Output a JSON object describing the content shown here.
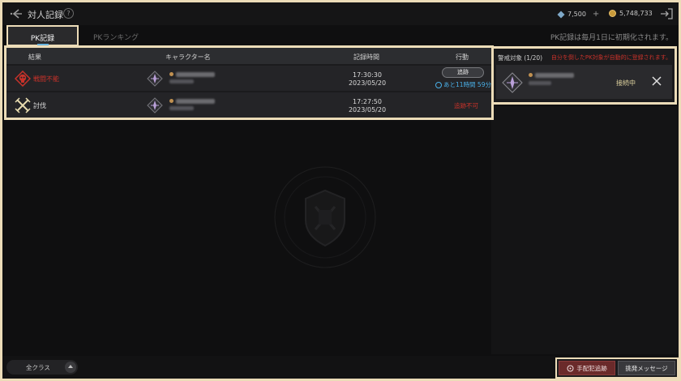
{
  "header": {
    "title": "対人記録",
    "help_glyph": "?",
    "gems": "7,500",
    "gems_plus": "+",
    "gold": "5,748,733"
  },
  "tabs": [
    {
      "label": "PK記録",
      "active": true
    },
    {
      "label": "PKランキング",
      "active": false
    }
  ],
  "reset_note": "PK記録は毎月1日に初期化されます。",
  "table": {
    "columns": [
      "結果",
      "キャラクター名",
      "記録時間",
      "行動"
    ],
    "rows": [
      {
        "result": "戦闘不能",
        "result_color": "#c8322a",
        "result_icon": "skull-icon",
        "time": "17:30:30",
        "date": "2023/05/20",
        "action_button": "追跡",
        "remaining": "あと11時間 59分"
      },
      {
        "result": "討伐",
        "result_color": "#dcdcdc",
        "result_icon": "crossed-swords-icon",
        "time": "17:27:50",
        "date": "2023/05/20",
        "action_status": "追跡不可"
      }
    ]
  },
  "watch_panel": {
    "title": "警戒対象 (1/20)",
    "note": "自分を倒したPK対象が自動的に登録されます。",
    "entries": [
      {
        "status": "接続中"
      }
    ]
  },
  "bottom": {
    "class_filter": "全クラス",
    "wanted_button": "手配犯追跡",
    "provoke_button": "挑発メッセージ"
  },
  "colors": {
    "accent_red": "#c8322a",
    "accent_blue": "#4ab0e8",
    "frame": "#ecdcb8"
  }
}
